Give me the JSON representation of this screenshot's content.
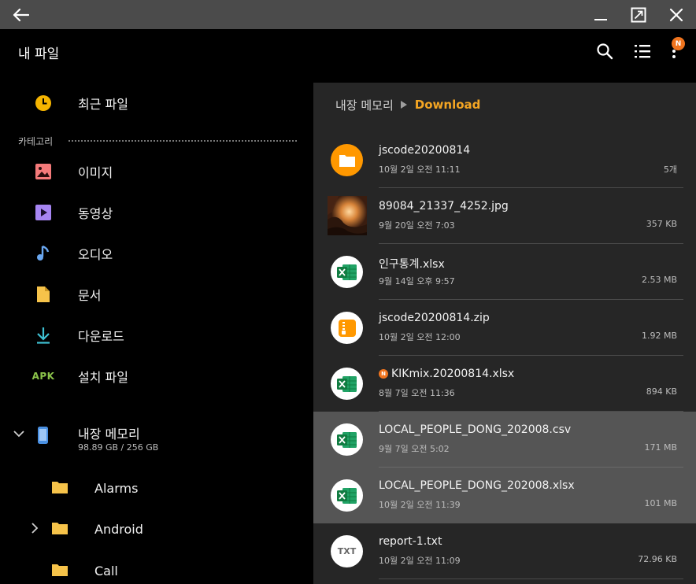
{
  "app": {
    "title": "내 파일",
    "badge": "N"
  },
  "colors": {
    "accent": "#f5a623",
    "badge": "#f0741e",
    "selected_row": "#555555",
    "right_panel_bg": "#262626",
    "titlebar_bg": "#4b4b4b"
  },
  "sidebar": {
    "recent_label": "최근 파일",
    "category_header": "카테고리",
    "categories": [
      {
        "label": "이미지",
        "icon": "image-icon"
      },
      {
        "label": "동영상",
        "icon": "video-icon"
      },
      {
        "label": "오디오",
        "icon": "audio-icon"
      },
      {
        "label": "문서",
        "icon": "document-icon"
      },
      {
        "label": "다운로드",
        "icon": "download-icon"
      },
      {
        "label": "설치 파일",
        "icon": "apk-icon",
        "icon_text": "APK"
      }
    ],
    "storage": {
      "name": "내장 메모리",
      "size": "98.89 GB / 256 GB"
    },
    "folders": [
      {
        "label": "Alarms",
        "expandable": false
      },
      {
        "label": "Android",
        "expandable": true
      },
      {
        "label": "Call",
        "expandable": false
      }
    ]
  },
  "breadcrumb": {
    "root": "내장 메모리",
    "current": "Download"
  },
  "files": [
    {
      "name": "jscode20200814",
      "date": "10월 2일 오전 11:11",
      "size": "5개",
      "icon": "folder-icon",
      "selected": false
    },
    {
      "name": "89084_21337_4252.jpg",
      "date": "9월 20일 오전 7:03",
      "size": "357 KB",
      "icon": "image-thumbnail",
      "selected": false
    },
    {
      "name": "인구통계.xlsx",
      "date": "9월 14일 오후 9:57",
      "size": "2.53 MB",
      "icon": "excel-icon",
      "selected": false
    },
    {
      "name": "jscode20200814.zip",
      "date": "10월 2일 오전 12:00",
      "size": "1.92 MB",
      "icon": "zip-icon",
      "selected": false
    },
    {
      "name": "KIKmix.20200814.xlsx",
      "date": "8월 7일 오전 11:36",
      "size": "894 KB",
      "icon": "excel-icon",
      "selected": false,
      "new_badge": "N"
    },
    {
      "name": "LOCAL_PEOPLE_DONG_202008.csv",
      "date": "9월 7일 오전 5:02",
      "size": "171 MB",
      "icon": "excel-icon",
      "selected": true
    },
    {
      "name": "LOCAL_PEOPLE_DONG_202008.xlsx",
      "date": "10월 2일 오전 11:39",
      "size": "101 MB",
      "icon": "excel-icon",
      "selected": true
    },
    {
      "name": "report-1.txt",
      "date": "10월 2일 오전 11:09",
      "size": "72.96 KB",
      "icon": "txt-icon",
      "icon_text": "TXT",
      "selected": false
    }
  ]
}
